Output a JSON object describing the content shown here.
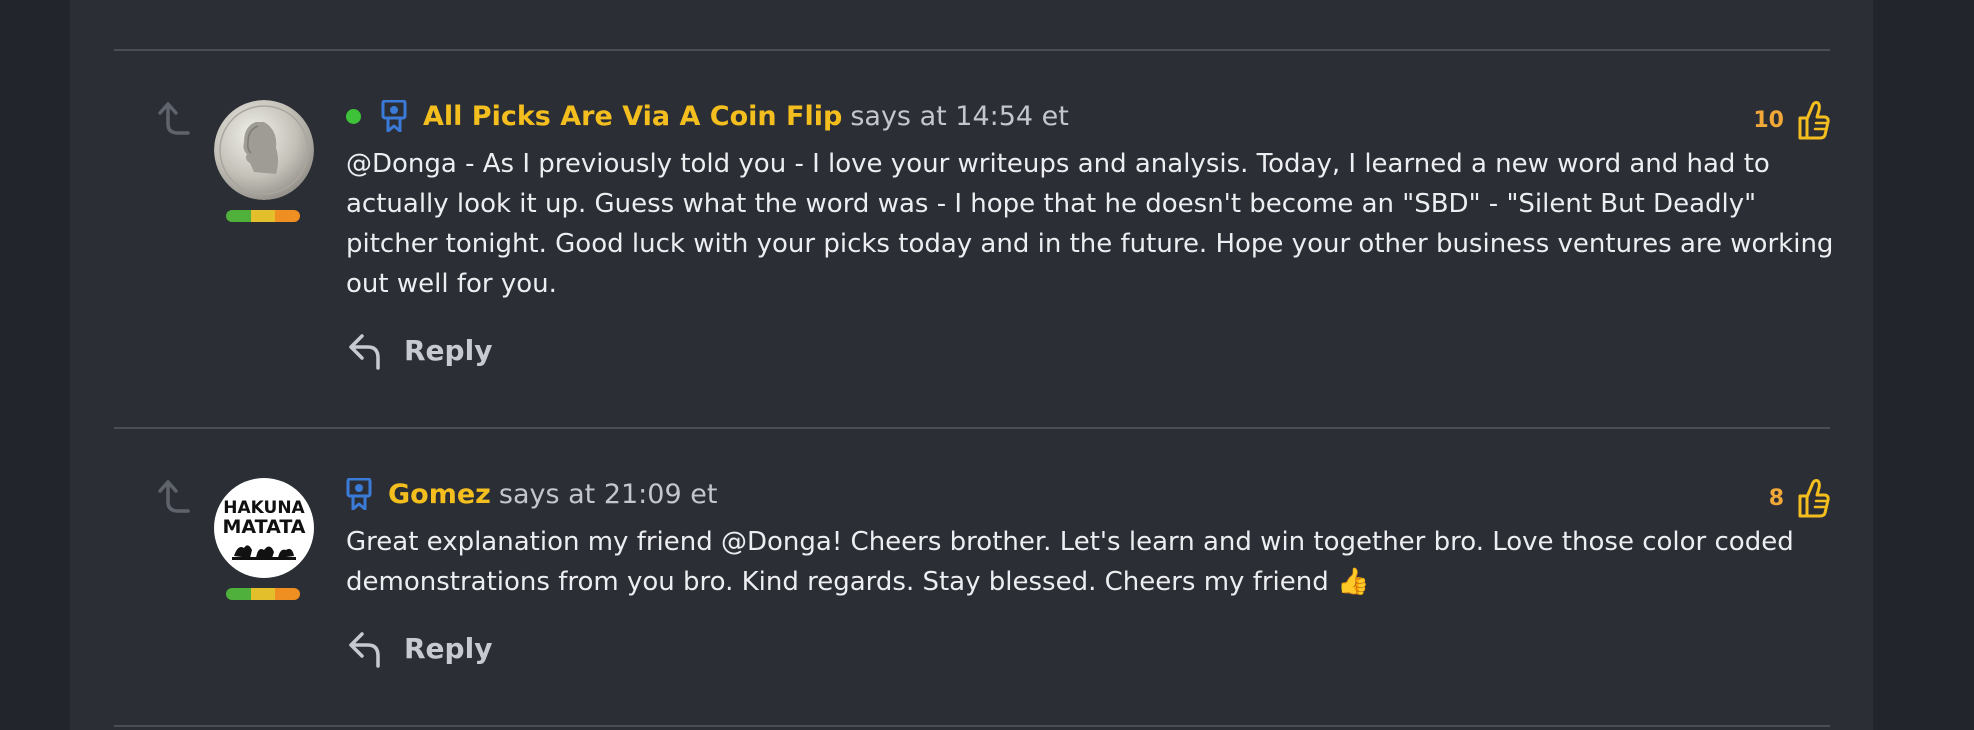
{
  "colors": {
    "background": "#22252b",
    "panel": "#2b2e35",
    "author": "#f4bf1e",
    "vote": "#f2a839",
    "online": "#3ec23a",
    "badge": "#3b7bd8"
  },
  "comments": [
    {
      "author": "All Picks Are Via A Coin Flip",
      "meta": "says at 14:54 et",
      "online": true,
      "badge_icon": "ribbon-badge-icon",
      "avatar_icon": "coin-avatar",
      "body": "@Donga - As I previously told you - I love your writeups and analysis. Today, I learned a new word and had to actually look it up. Guess what the word was - I hope that he doesn't become an \"SBD\" - \"Silent But Deadly\" pitcher tonight. Good luck with your picks today and in the future. Hope your other business ventures are working out well for you.",
      "reply_label": "Reply",
      "votes": "10"
    },
    {
      "author": "Gomez",
      "meta": "says at 21:09 et",
      "online": false,
      "badge_icon": "ribbon-badge-icon",
      "avatar_text": [
        "HAKUNA",
        "MATATA"
      ],
      "body": "Great explanation my friend @Donga! Cheers brother. Let's learn and win together bro. Love those color coded demonstrations from you bro. Kind regards. Stay blessed. Cheers my friend 👍",
      "reply_label": "Reply",
      "votes": "8"
    }
  ]
}
